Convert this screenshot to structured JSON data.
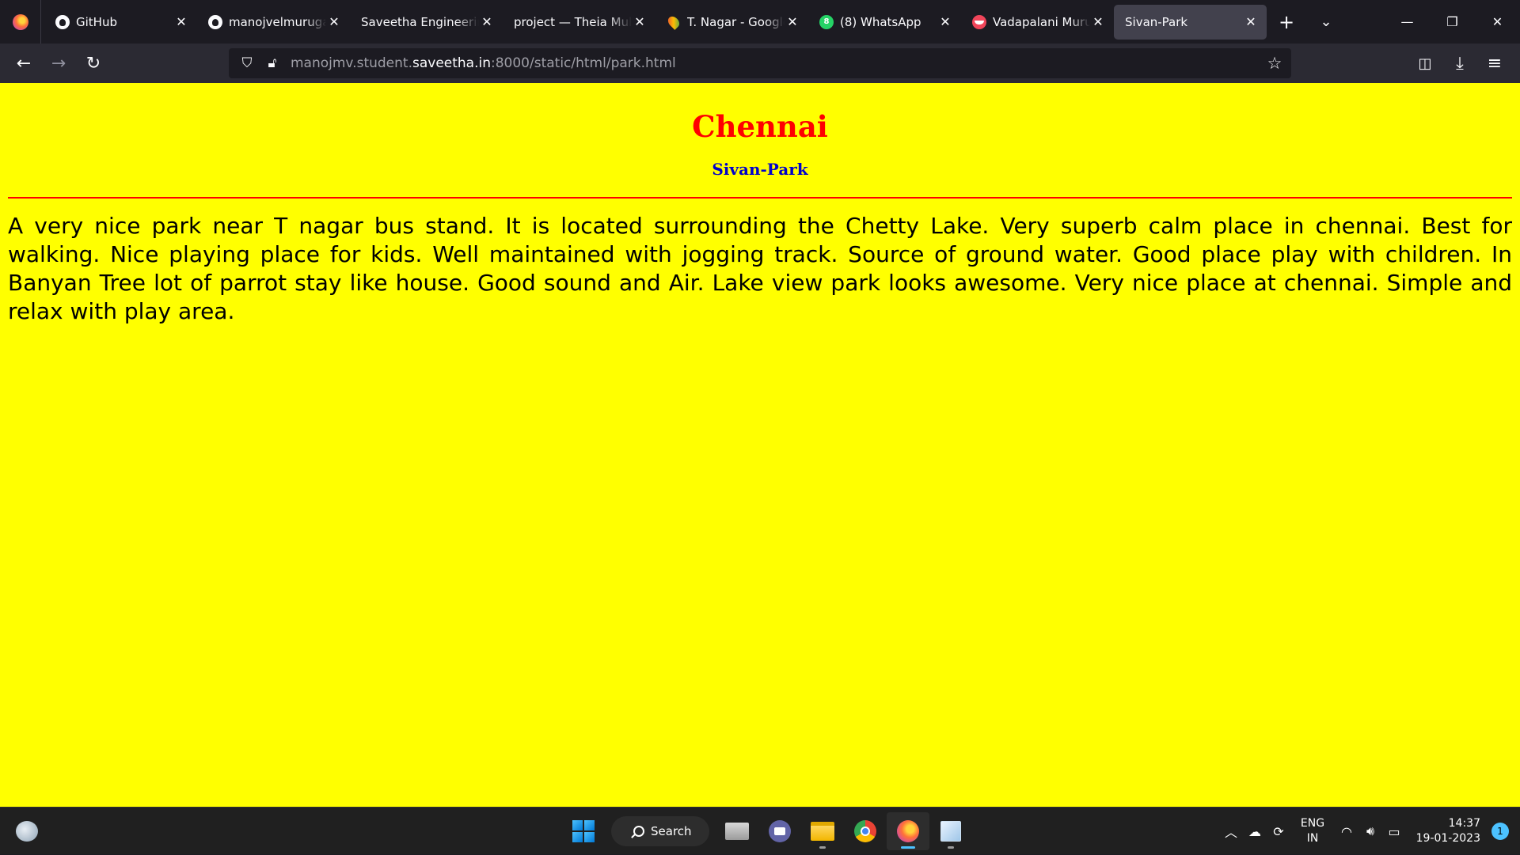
{
  "browser": {
    "tabs": [
      {
        "title": "GitHub",
        "favicon": "github-icon"
      },
      {
        "title": "manojvelmurugan",
        "favicon": "github-icon"
      },
      {
        "title": "Saveetha Engineering",
        "favicon": "none"
      },
      {
        "title": "project — Theia Multi-",
        "favicon": "none"
      },
      {
        "title": "T. Nagar - Google",
        "favicon": "maps-pin-icon"
      },
      {
        "title": "(8) WhatsApp",
        "favicon": "whatsapp-icon",
        "badge": "8"
      },
      {
        "title": "Vadapalani Murug",
        "favicon": "vadapalani-icon"
      },
      {
        "title": "Sivan-Park",
        "favicon": "none",
        "active": true
      }
    ],
    "url_prefix": "manojmv.student.",
    "url_host": "saveetha.in",
    "url_suffix": ":8000/static/html/park.html"
  },
  "page": {
    "heading": "Chennai",
    "subheading": "Sivan-Park",
    "body": "A very nice park near T nagar bus stand. It is located surrounding the Chetty Lake. Very superb calm place in chennai. Best for walking. Nice playing place for kids. Well maintained with jogging track. Source of ground water. Good place play with children. In Banyan Tree lot of parrot stay like house. Good sound and Air. Lake view park looks awesome. Very nice place at chennai. Simple and relax with play area.",
    "background_color": "#ffff00",
    "heading_color": "#ff0000",
    "subheading_color": "#0000cc"
  },
  "taskbar": {
    "search_label": "Search",
    "lang_line1": "ENG",
    "lang_line2": "IN",
    "time": "14:37",
    "date": "19-01-2023",
    "notification_count": "1"
  }
}
